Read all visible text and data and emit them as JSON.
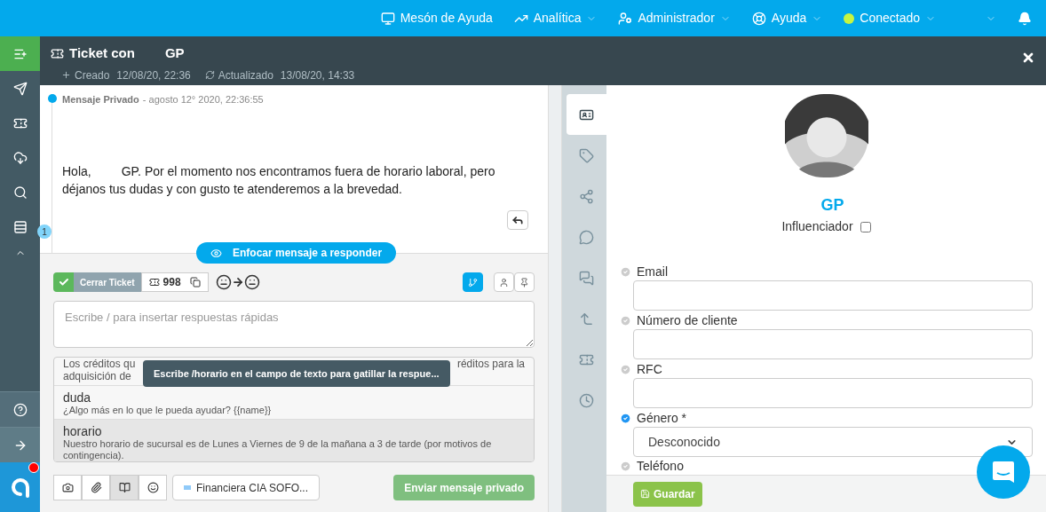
{
  "topnav": {
    "items": [
      {
        "label": "Mesón de Ayuda",
        "kind": "monitor",
        "dropdown": false
      },
      {
        "label": "Analítica",
        "kind": "chart",
        "dropdown": true
      },
      {
        "label": "Administrador",
        "kind": "admin",
        "dropdown": true
      },
      {
        "label": "Ayuda",
        "kind": "lifebuoy",
        "dropdown": true
      },
      {
        "label": "Conectado",
        "kind": "status",
        "dropdown": true,
        "color": "#c6f542"
      }
    ]
  },
  "sidebar": {
    "items": [
      {
        "kind": "new",
        "selected": true
      },
      {
        "kind": "send",
        "selected": false
      },
      {
        "kind": "ticket",
        "selected": false
      },
      {
        "kind": "download",
        "selected": false
      },
      {
        "kind": "search",
        "selected": false
      },
      {
        "kind": "list",
        "selected": false
      },
      {
        "kind": "collapse",
        "selected": false
      }
    ],
    "bottom": [
      {
        "kind": "help"
      },
      {
        "kind": "exit"
      },
      {
        "kind": "logo",
        "badge": true
      }
    ]
  },
  "ticket": {
    "title_start": "Ticket con",
    "title_end": "GP",
    "created_label": "Creado",
    "created": "12/08/20, 22:36",
    "updated_label": "Actualizado",
    "updated": "13/08/20, 14:33"
  },
  "message": {
    "title": "Mensaje Privado",
    "date": "- agosto 12° 2020, 22:36:55",
    "greeting": "Hola,",
    "body": "GP. Por el momento nos encontramos fuera de horario laboral, pero déjanos tus dudas y con gusto te atenderemos a la brevedad.",
    "count": "1"
  },
  "focus_button": "Enfocar mensaje a responder",
  "composer": {
    "close_label": "Cerrar Ticket",
    "ticket_number": "998",
    "tools": [
      {
        "kind": "branch",
        "selected": true
      },
      {
        "kind": "person",
        "selected": false
      },
      {
        "kind": "pin",
        "selected": false
      }
    ],
    "placeholder": "Escribe / para insertar respuestas rápidas",
    "quick_replies": [
      {
        "kind": "covered",
        "line1_start": "Los créditos qu",
        "line1_end": "réditos para la",
        "line2_start": "adquisición de",
        "selected": false
      },
      {
        "kind": "full",
        "title": "duda",
        "text": "¿Algo más en lo que le pueda ayudar? {{name}}",
        "selected": false
      },
      {
        "kind": "full",
        "title": "horario",
        "text": "Nuestro horario de sucursal es de Lunes a Viernes de 9 de la mañana a 3 de tarde (por motivos de contingencia).",
        "selected": true
      }
    ],
    "tooltip": "Escribe /horario en el campo de texto para gatillar la respue...",
    "attach": [
      {
        "kind": "camera",
        "selected": false
      },
      {
        "kind": "clip",
        "selected": false
      },
      {
        "kind": "book",
        "selected": true
      },
      {
        "kind": "smile",
        "selected": false
      }
    ],
    "channel": "Financiera CIA SOFO...",
    "send": {
      "label": "Enviar mensaje privado",
      "disabled": true
    }
  },
  "side_tabs": [
    {
      "kind": "card",
      "selected": true
    },
    {
      "kind": "tag",
      "selected": false
    },
    {
      "kind": "network",
      "selected": false
    },
    {
      "kind": "bubble",
      "selected": false
    },
    {
      "kind": "bubbles",
      "selected": false
    },
    {
      "kind": "arrow",
      "selected": false
    },
    {
      "kind": "ticket",
      "selected": false
    },
    {
      "kind": "clock",
      "selected": false
    }
  ],
  "contact": {
    "name": "GP",
    "influencer_label": "Influenciador",
    "influencer": false,
    "fields": [
      {
        "label": "Email",
        "kind": "input",
        "checked": false
      },
      {
        "label": "Número de cliente",
        "kind": "input",
        "checked": false
      },
      {
        "label": "RFC",
        "kind": "input",
        "checked": false
      },
      {
        "label": "Género *",
        "kind": "select",
        "value": "Desconocido",
        "checked": true
      },
      {
        "label": "Teléfono",
        "kind": "label",
        "checked": false
      }
    ],
    "save": "Guardar"
  }
}
